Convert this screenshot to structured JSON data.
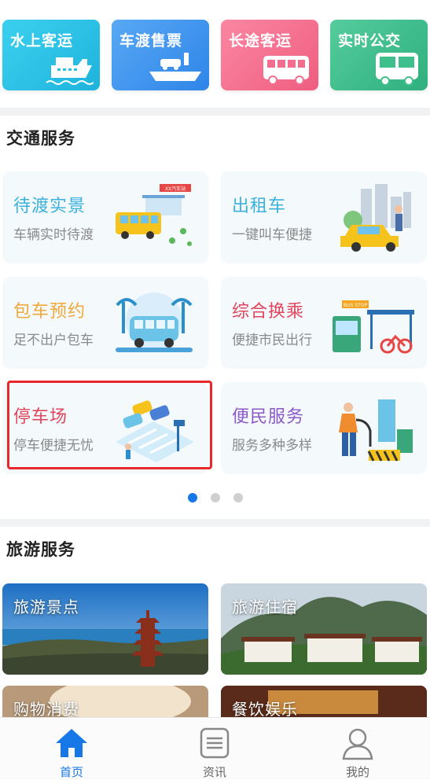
{
  "quick_tiles": [
    {
      "label": "水上客运",
      "color": "#27c3e6"
    },
    {
      "label": "车渡售票",
      "color": "#3d92ee"
    },
    {
      "label": "长途客运",
      "color": "#f26d8e"
    },
    {
      "label": "实时公交",
      "color": "#3ebf8b"
    }
  ],
  "traffic": {
    "title": "交通服务",
    "cards": [
      {
        "title": "待渡实景",
        "subtitle": "车辆实时待渡",
        "color": "#3bb1de"
      },
      {
        "title": "出租车",
        "subtitle": "一键叫车便捷",
        "color": "#3bb1de"
      },
      {
        "title": "包车预约",
        "subtitle": "足不出户包车",
        "color": "#f0a83a"
      },
      {
        "title": "综合换乘",
        "subtitle": "便捷市民出行",
        "color": "#e0465b"
      },
      {
        "title": "停车场",
        "subtitle": "停车便捷无忧",
        "color": "#e0465b"
      },
      {
        "title": "便民服务",
        "subtitle": "服务多种多样",
        "color": "#8b59c9"
      }
    ],
    "illustration_text": {
      "station_sign": "XX汽车站",
      "bus_stop_sign": "BUS STOP"
    },
    "pager": {
      "pages": 3,
      "active": 0
    }
  },
  "tourism": {
    "title": "旅游服务",
    "tiles": [
      {
        "label": "旅游景点"
      },
      {
        "label": "旅游住宿"
      },
      {
        "label": "购物消费"
      },
      {
        "label": "餐饮娱乐"
      }
    ]
  },
  "tabbar": {
    "tabs": [
      {
        "label": "首页",
        "icon": "home-icon",
        "active": true
      },
      {
        "label": "资讯",
        "icon": "news-icon",
        "active": false
      },
      {
        "label": "我的",
        "icon": "profile-icon",
        "active": false
      }
    ],
    "active_color": "#1677e6"
  }
}
